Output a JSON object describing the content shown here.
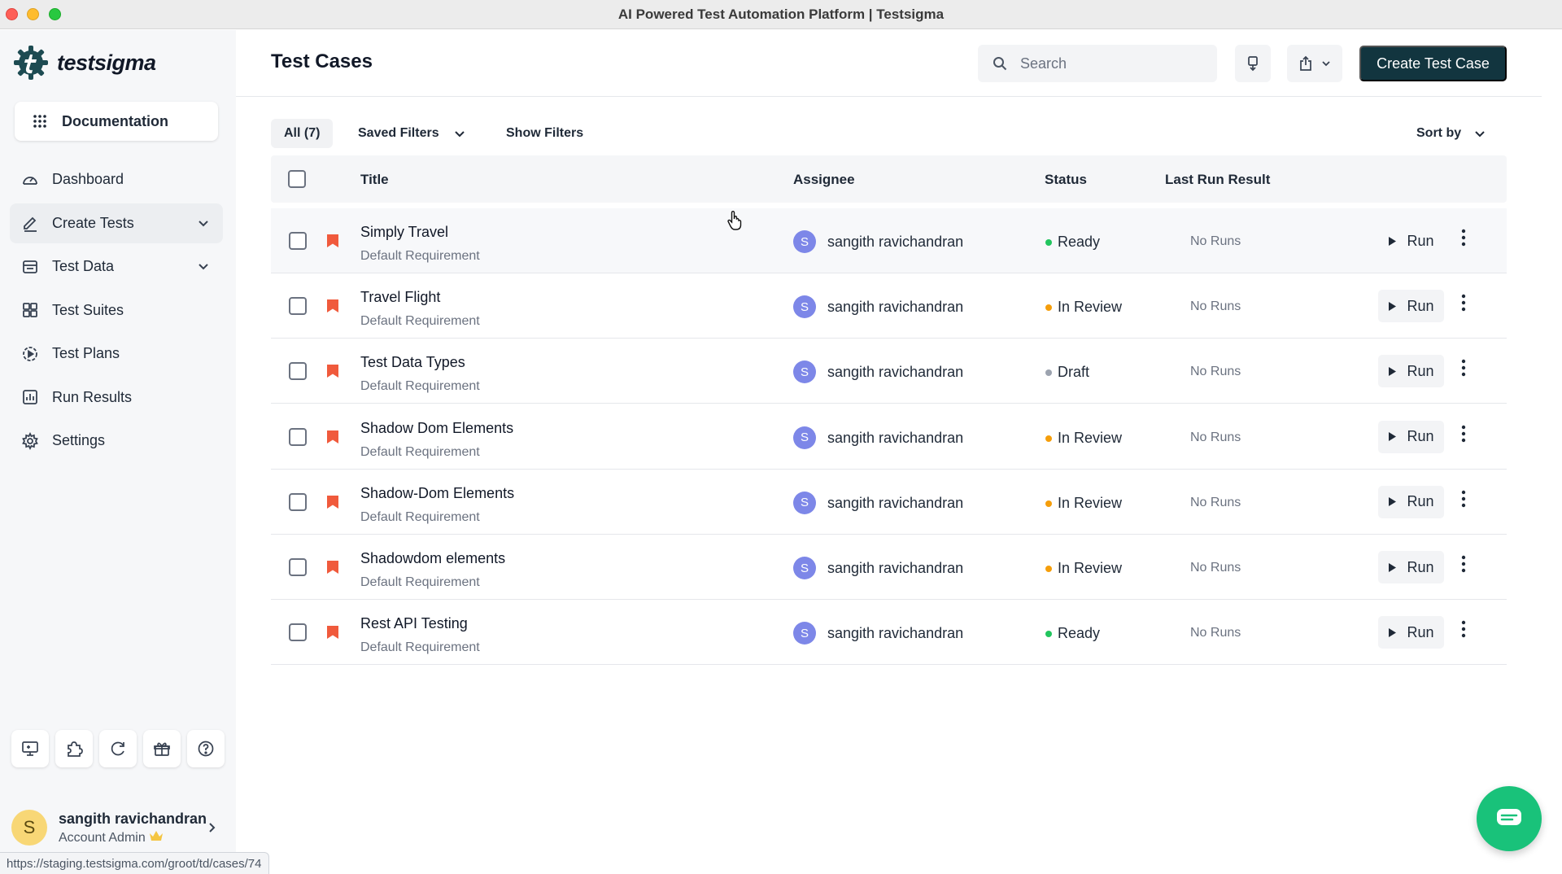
{
  "window": {
    "title": "AI Powered Test Automation Platform | Testsigma"
  },
  "brand": {
    "name": "testsigma",
    "accent": "#12353f",
    "logo_color": "#1d4b52"
  },
  "sidebar": {
    "documentation": "Documentation",
    "items": [
      {
        "label": "Dashboard",
        "icon": "dashboard-icon"
      },
      {
        "label": "Create Tests",
        "icon": "pencil-icon",
        "expandable": true,
        "active": true
      },
      {
        "label": "Test Data",
        "icon": "data-icon",
        "expandable": true
      },
      {
        "label": "Test Suites",
        "icon": "grid-icon"
      },
      {
        "label": "Test Plans",
        "icon": "play-circle-icon"
      },
      {
        "label": "Run Results",
        "icon": "bar-chart-icon"
      },
      {
        "label": "Settings",
        "icon": "gear-icon"
      }
    ],
    "bottom_icons": [
      "screen-recorder-icon",
      "puzzle-icon",
      "refresh-icon",
      "gift-icon",
      "help-icon"
    ],
    "user": {
      "initial": "S",
      "name": "sangith ravichandran",
      "role": "Account Admin",
      "role_icon": "crown-icon"
    }
  },
  "status_url": "https://staging.testsigma.com/groot/td/cases/74",
  "header": {
    "title": "Test Cases",
    "search_placeholder": "Search",
    "create_label": "Create Test Case"
  },
  "filters": {
    "all": "All (7)",
    "saved": "Saved Filters",
    "show": "Show Filters",
    "sort": "Sort by"
  },
  "table": {
    "columns": {
      "title": "Title",
      "assignee": "Assignee",
      "status": "Status",
      "last_run": "Last Run Result"
    },
    "status_colors": {
      "Ready": "#22c55e",
      "In Review": "#f59e0b",
      "Draft": "#9ca3af"
    },
    "rows": [
      {
        "title": "Simply Travel",
        "sub": "Default Requirement",
        "initial": "S",
        "assignee": "sangith ravichandran",
        "status": "Ready",
        "last_run": "No Runs",
        "run": "Run"
      },
      {
        "title": "Travel Flight",
        "sub": "Default Requirement",
        "initial": "S",
        "assignee": "sangith ravichandran",
        "status": "In Review",
        "last_run": "No Runs",
        "run": "Run"
      },
      {
        "title": "Test Data Types",
        "sub": "Default Requirement",
        "initial": "S",
        "assignee": "sangith ravichandran",
        "status": "Draft",
        "last_run": "No Runs",
        "run": "Run"
      },
      {
        "title": "Shadow Dom Elements",
        "sub": "Default Requirement",
        "initial": "S",
        "assignee": "sangith ravichandran",
        "status": "In Review",
        "last_run": "No Runs",
        "run": "Run"
      },
      {
        "title": "Shadow-Dom Elements",
        "sub": "Default Requirement",
        "initial": "S",
        "assignee": "sangith ravichandran",
        "status": "In Review",
        "last_run": "No Runs",
        "run": "Run"
      },
      {
        "title": "Shadowdom elements",
        "sub": "Default Requirement",
        "initial": "S",
        "assignee": "sangith ravichandran",
        "status": "In Review",
        "last_run": "No Runs",
        "run": "Run"
      },
      {
        "title": "Rest API Testing",
        "sub": "Default Requirement",
        "initial": "S",
        "assignee": "sangith ravichandran",
        "status": "Ready",
        "last_run": "No Runs",
        "run": "Run"
      }
    ]
  }
}
